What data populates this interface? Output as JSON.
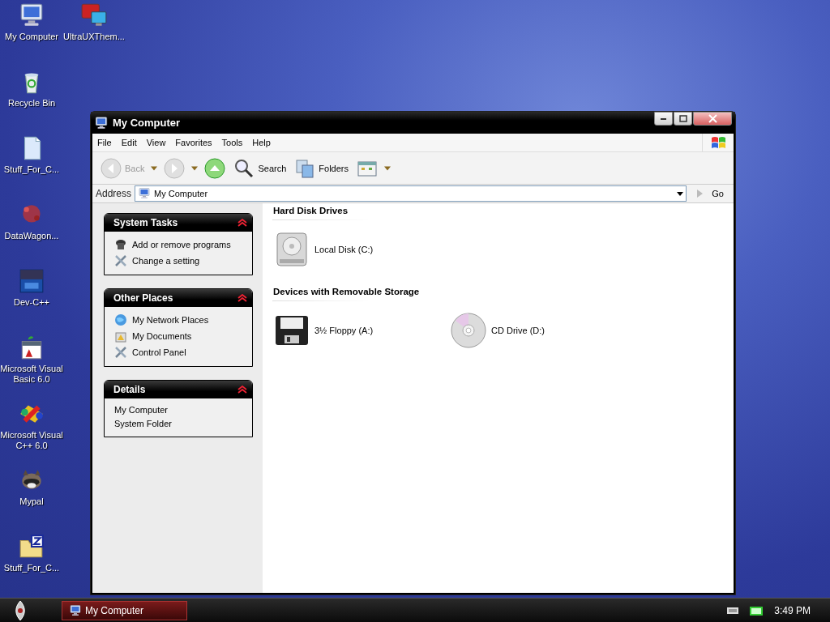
{
  "desktop_icons": [
    {
      "label": "My Computer",
      "kind": "computer"
    },
    {
      "label": "UltraUXThem...",
      "kind": "monitors"
    },
    {
      "label": "Recycle Bin",
      "kind": "recycle"
    },
    {
      "label": "Stuff_For_C...",
      "kind": "document"
    },
    {
      "label": "DataWagon...",
      "kind": "splat"
    },
    {
      "label": "Dev-C++",
      "kind": "dev"
    },
    {
      "label": "Microsoft Visual Basic 6.0",
      "kind": "vb"
    },
    {
      "label": "Microsoft Visual C++ 6.0",
      "kind": "vc"
    },
    {
      "label": "Mypal",
      "kind": "raccoon"
    },
    {
      "label": "Stuff_For_C...",
      "kind": "zipfolder"
    }
  ],
  "window": {
    "title": "My Computer",
    "menu": [
      "File",
      "Edit",
      "View",
      "Favorites",
      "Tools",
      "Help"
    ],
    "toolbar": [
      {
        "kind": "back",
        "label": "Back",
        "disabled": true
      },
      {
        "kind": "forward",
        "disabled": true
      },
      {
        "kind": "up",
        "disabled": false
      },
      {
        "kind": "search",
        "label": "Search"
      },
      {
        "kind": "folders",
        "label": "Folders"
      },
      {
        "kind": "views"
      }
    ],
    "address": {
      "label": "Address",
      "value": "My Computer",
      "go": "Go"
    },
    "task_panels": [
      {
        "title": "System Tasks",
        "expanded": true,
        "items": [
          {
            "label": "Add or remove programs",
            "kind": "cd"
          },
          {
            "label": "Change a setting",
            "kind": "tools"
          }
        ]
      },
      {
        "title": "Other Places",
        "expanded": true,
        "items": [
          {
            "label": "My Network Places",
            "kind": "globe"
          },
          {
            "label": "My Documents",
            "kind": "docs"
          },
          {
            "label": "Control Panel",
            "kind": "tools"
          }
        ]
      },
      {
        "title": "Details",
        "expanded": true,
        "lines": [
          "My Computer",
          "System Folder"
        ]
      }
    ],
    "sections": [
      {
        "heading": "Hard Disk Drives",
        "items": [
          {
            "label": "Local Disk (C:)",
            "kind": "harddisk"
          }
        ]
      },
      {
        "heading": "Devices with Removable Storage",
        "items": [
          {
            "label": "3½ Floppy (A:)",
            "kind": "floppy"
          },
          {
            "label": "CD Drive (D:)",
            "kind": "cd"
          }
        ]
      }
    ]
  },
  "taskbar": {
    "tasks": [
      {
        "label": "My Computer",
        "selected": true
      }
    ],
    "clock": "3:49 PM"
  }
}
